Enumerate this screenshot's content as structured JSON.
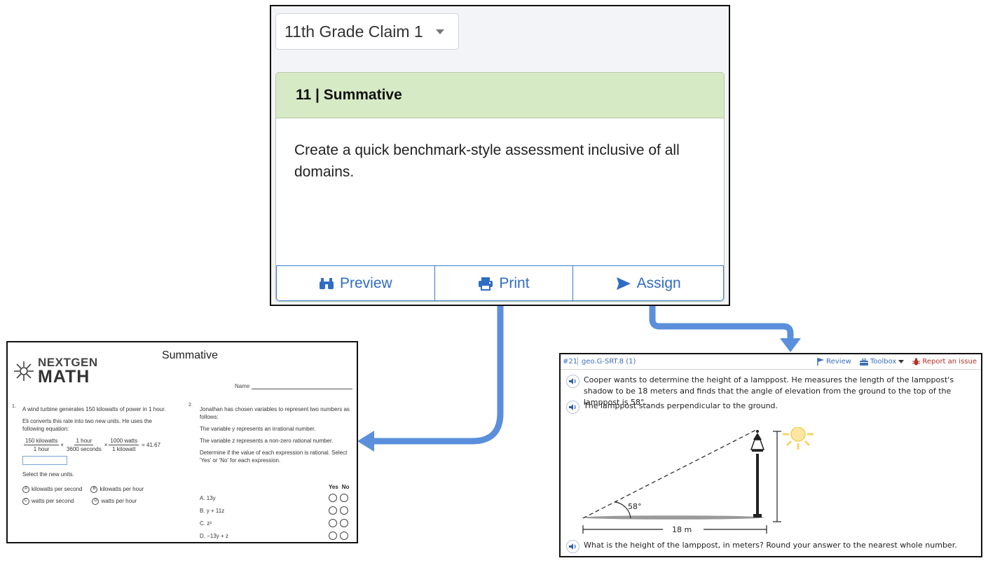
{
  "selector": {
    "value": "11th Grade Claim 1"
  },
  "card": {
    "title": "11 | Summative",
    "description": "Create a quick benchmark-style assessment inclusive of all domains.",
    "actions": {
      "preview": "Preview",
      "print": "Print",
      "assign": "Assign"
    }
  },
  "colors": {
    "accent_blue": "#2f6cc4",
    "header_green": "#d7eac6",
    "arrow_blue": "#5b8fdc",
    "report_red": "#b33025"
  },
  "print_doc": {
    "title": "Summative",
    "logo_top": "NEXTGEN",
    "logo_bottom": "MATH",
    "name_label": "Name",
    "q1": {
      "number": "1.",
      "p1": "A wind turbine generates 150 kilowatts of power in 1 hour.",
      "p2": "Eli converts this rate into two new units. He uses the following equation:",
      "frac1_num": "150 kilowatts",
      "frac1_den": "1 hour",
      "frac2_num": "1 hour",
      "frac2_den": "3600 seconds",
      "frac3_num": "1000 watts",
      "frac3_den": "1 kilowatt",
      "result": "= 41.67",
      "p3": "Select the new units.",
      "choices": [
        {
          "letter": "A",
          "text": "kilowatts per second"
        },
        {
          "letter": "B",
          "text": "kilowatts per hour"
        },
        {
          "letter": "C",
          "text": "watts per second"
        },
        {
          "letter": "D",
          "text": "watts per hour"
        }
      ]
    },
    "q2": {
      "number": "2.",
      "p1": "Jonathan has chosen variables to represent two numbers as follows:",
      "p2": "The variable y represents an irrational number.",
      "p3": "The variable z represents a non-zero rational number.",
      "p4": "Determine if the value of each expression is rational. Select 'Yes' or 'No' for each expression.",
      "yes": "Yes",
      "no": "No",
      "expressions": [
        "A. 13y",
        "B. y + 11z",
        "C. z²",
        "D. −13y + z"
      ]
    }
  },
  "assign_doc": {
    "item_number": "#21",
    "standard": "geo.G-SRT.8 (1)",
    "tools": {
      "review": "Review",
      "toolbox": "Toolbox",
      "report": "Report an issue"
    },
    "paragraph1": "Cooper wants to determine the height of a lamppost. He measures the length of the lamppost's shadow to be 18 meters and finds that the angle of elevation from the ground to the top of the lamppost is 58°.",
    "paragraph2": "The lamppost stands perpendicular to the ground.",
    "diagram": {
      "angle_label": "58°",
      "length_label": "18 m"
    },
    "question": "What is the height of the lamppost, in meters? Round your answer to the nearest whole number."
  }
}
